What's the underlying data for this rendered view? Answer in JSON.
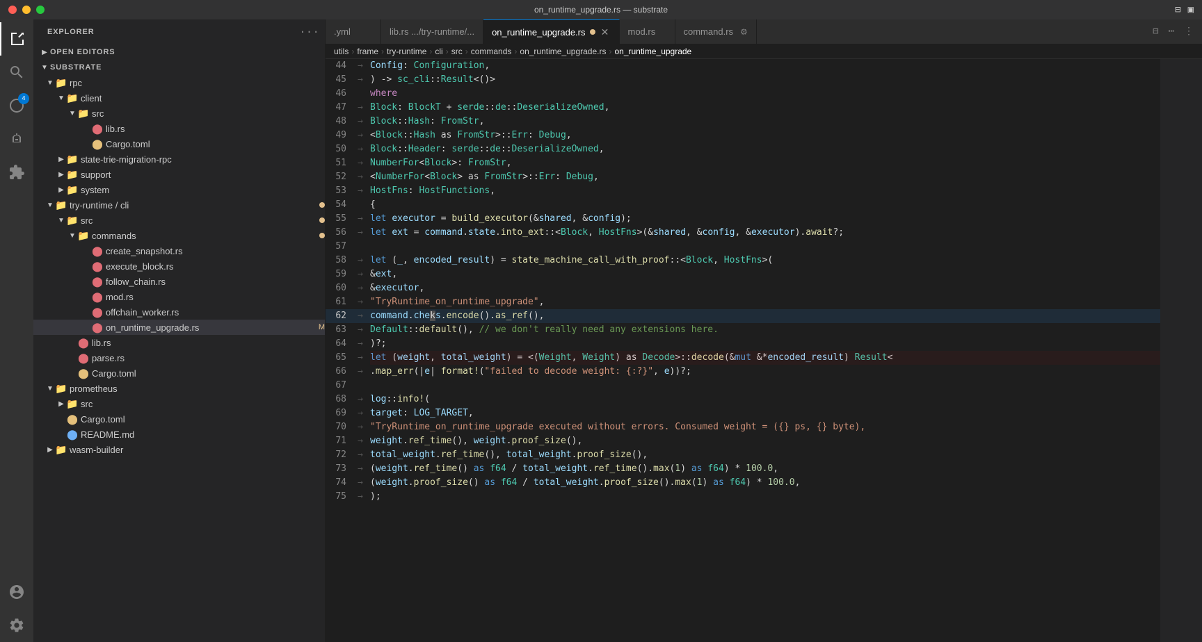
{
  "titleBar": {
    "title": "on_runtime_upgrade.rs — substrate"
  },
  "tabs": [
    {
      "id": "tab-yaml",
      "label": ".yml",
      "active": false,
      "modified": false,
      "closeable": false
    },
    {
      "id": "tab-lib",
      "label": "lib.rs .../try-runtime/...",
      "active": false,
      "modified": false,
      "closeable": false
    },
    {
      "id": "tab-on-runtime",
      "label": "on_runtime_upgrade.rs",
      "active": true,
      "modified": true,
      "closeable": true
    },
    {
      "id": "tab-mod",
      "label": "mod.rs",
      "active": false,
      "modified": false,
      "closeable": false
    },
    {
      "id": "tab-command",
      "label": "command.rs",
      "active": false,
      "modified": false,
      "closeable": false
    }
  ],
  "breadcrumb": [
    "utils",
    "frame",
    "try-runtime",
    "cli",
    "src",
    "commands",
    "on_runtime_upgrade.rs",
    "on_runtime_upgrade"
  ],
  "sidebar": {
    "explorerLabel": "EXPLORER",
    "openEditorsLabel": "OPEN EDITORS",
    "rootLabel": "SUBSTRATE",
    "tree": [
      {
        "id": "rpc",
        "label": "rpc",
        "type": "folder",
        "indent": 1,
        "open": true
      },
      {
        "id": "client",
        "label": "client",
        "type": "folder",
        "indent": 2,
        "open": true
      },
      {
        "id": "src-client",
        "label": "src",
        "type": "folder",
        "indent": 3,
        "open": true
      },
      {
        "id": "lib-client",
        "label": "lib.rs",
        "type": "file-rs",
        "indent": 4
      },
      {
        "id": "cargo-client",
        "label": "Cargo.toml",
        "type": "file-toml",
        "indent": 4
      },
      {
        "id": "state-trie",
        "label": "state-trie-migration-rpc",
        "type": "folder",
        "indent": 2,
        "open": false
      },
      {
        "id": "support",
        "label": "support",
        "type": "folder",
        "indent": 2,
        "open": false
      },
      {
        "id": "system",
        "label": "system",
        "type": "folder",
        "indent": 2,
        "open": false
      },
      {
        "id": "try-runtime-cli",
        "label": "try-runtime / cli",
        "type": "folder",
        "indent": 1,
        "open": true,
        "dot": "yellow"
      },
      {
        "id": "src-try",
        "label": "src",
        "type": "folder",
        "indent": 2,
        "open": true,
        "dot": "yellow"
      },
      {
        "id": "commands",
        "label": "commands",
        "type": "folder",
        "indent": 3,
        "open": true,
        "dot": "yellow"
      },
      {
        "id": "create-snapshot",
        "label": "create_snapshot.rs",
        "type": "file-rs",
        "indent": 4
      },
      {
        "id": "execute-block",
        "label": "execute_block.rs",
        "type": "file-rs",
        "indent": 4
      },
      {
        "id": "follow-chain",
        "label": "follow_chain.rs",
        "type": "file-rs",
        "indent": 4
      },
      {
        "id": "mod-rs",
        "label": "mod.rs",
        "type": "file-rs",
        "indent": 4
      },
      {
        "id": "offchain-worker",
        "label": "offchain_worker.rs",
        "type": "file-rs",
        "indent": 4
      },
      {
        "id": "on-runtime-upgrade",
        "label": "on_runtime_upgrade.rs",
        "type": "file-rs",
        "indent": 4,
        "badge": "M",
        "selected": true
      },
      {
        "id": "lib-try",
        "label": "lib.rs",
        "type": "file-rs",
        "indent": 3
      },
      {
        "id": "parse-rs",
        "label": "parse.rs",
        "type": "file-rs",
        "indent": 3
      },
      {
        "id": "cargo-try",
        "label": "Cargo.toml",
        "type": "file-toml",
        "indent": 3
      },
      {
        "id": "prometheus",
        "label": "prometheus",
        "type": "folder",
        "indent": 1,
        "open": true
      },
      {
        "id": "src-prom",
        "label": "src",
        "type": "folder",
        "indent": 2,
        "open": false
      },
      {
        "id": "cargo-prom",
        "label": "Cargo.toml",
        "type": "file-toml",
        "indent": 2
      },
      {
        "id": "readme-prom",
        "label": "README.md",
        "type": "file-md",
        "indent": 2
      },
      {
        "id": "wasm-builder",
        "label": "wasm-builder",
        "type": "folder",
        "indent": 1,
        "open": false
      }
    ]
  },
  "codeLines": [
    {
      "num": 44,
      "indent": 0,
      "content": "    Config: Configuration,"
    },
    {
      "num": 45,
      "indent": 0,
      "content": ") -> sc_cli::Result<()>"
    },
    {
      "num": 46,
      "indent": 0,
      "content": "where"
    },
    {
      "num": 47,
      "indent": 1,
      "content": "    Block: BlockT + serde::de::DeserializeOwned,"
    },
    {
      "num": 48,
      "indent": 1,
      "content": "    Block::Hash: FromStr,"
    },
    {
      "num": 49,
      "indent": 1,
      "content": "    <Block::Hash as FromStr>::Err: Debug,"
    },
    {
      "num": 50,
      "indent": 1,
      "content": "    Block::Header: serde::de::DeserializeOwned,"
    },
    {
      "num": 51,
      "indent": 1,
      "content": "    NumberFor<Block>: FromStr,"
    },
    {
      "num": 52,
      "indent": 1,
      "content": "    <NumberFor<Block> as FromStr>::Err: Debug,"
    },
    {
      "num": 53,
      "indent": 1,
      "content": "    HostFns: HostFunctions,"
    },
    {
      "num": 54,
      "indent": 0,
      "content": "{"
    },
    {
      "num": 55,
      "indent": 1,
      "content": "    let executor = build_executor(&shared, &config);"
    },
    {
      "num": 56,
      "indent": 1,
      "content": "    let ext = command.state.into_ext::<Block, HostFns>(&shared, &config, &executor).await?;"
    },
    {
      "num": 57,
      "indent": 0,
      "content": ""
    },
    {
      "num": 58,
      "indent": 1,
      "content": "    let (_, encoded_result) = state_machine_call_with_proof::<Block, HostFns>("
    },
    {
      "num": 59,
      "indent": 2,
      "content": "        &ext,"
    },
    {
      "num": 60,
      "indent": 2,
      "content": "        &executor,"
    },
    {
      "num": 61,
      "indent": 2,
      "content": "        \"TryRuntime_on_runtime_upgrade\","
    },
    {
      "num": 62,
      "indent": 2,
      "content": "        command.checks.encode().as_ref(),"
    },
    {
      "num": 63,
      "indent": 2,
      "content": "        Default::default(), // we don't really need any extensions here."
    },
    {
      "num": 64,
      "indent": 1,
      "content": "    )?;"
    },
    {
      "num": 65,
      "indent": 1,
      "content": "    let (weight, total_weight) = <(Weight, Weight) as Decode>::decode(&mut &*encoded_result) Result<"
    },
    {
      "num": 66,
      "indent": 2,
      "content": "        .map_err(|e| format!(\"failed to decode weight: {:?}\", e))?;"
    },
    {
      "num": 67,
      "indent": 0,
      "content": ""
    },
    {
      "num": 68,
      "indent": 1,
      "content": "    log::info!("
    },
    {
      "num": 69,
      "indent": 2,
      "content": "        target: LOG_TARGET,"
    },
    {
      "num": 70,
      "indent": 2,
      "content": "        \"TryRuntime_on_runtime_upgrade executed without errors. Consumed weight = ({} ps, {} byte),"
    },
    {
      "num": 71,
      "indent": 2,
      "content": "        weight.ref_time(), weight.proof_size(),"
    },
    {
      "num": 72,
      "indent": 2,
      "content": "        total_weight.ref_time(), total_weight.proof_size(),"
    },
    {
      "num": 73,
      "indent": 2,
      "content": "        (weight.ref_time() as f64 / total_weight.ref_time().max(1) as f64) * 100.0,"
    },
    {
      "num": 74,
      "indent": 2,
      "content": "        (weight.proof_size() as f64 / total_weight.proof_size().max(1) as f64) * 100.0,"
    },
    {
      "num": 75,
      "indent": 1,
      "content": "    );"
    }
  ]
}
